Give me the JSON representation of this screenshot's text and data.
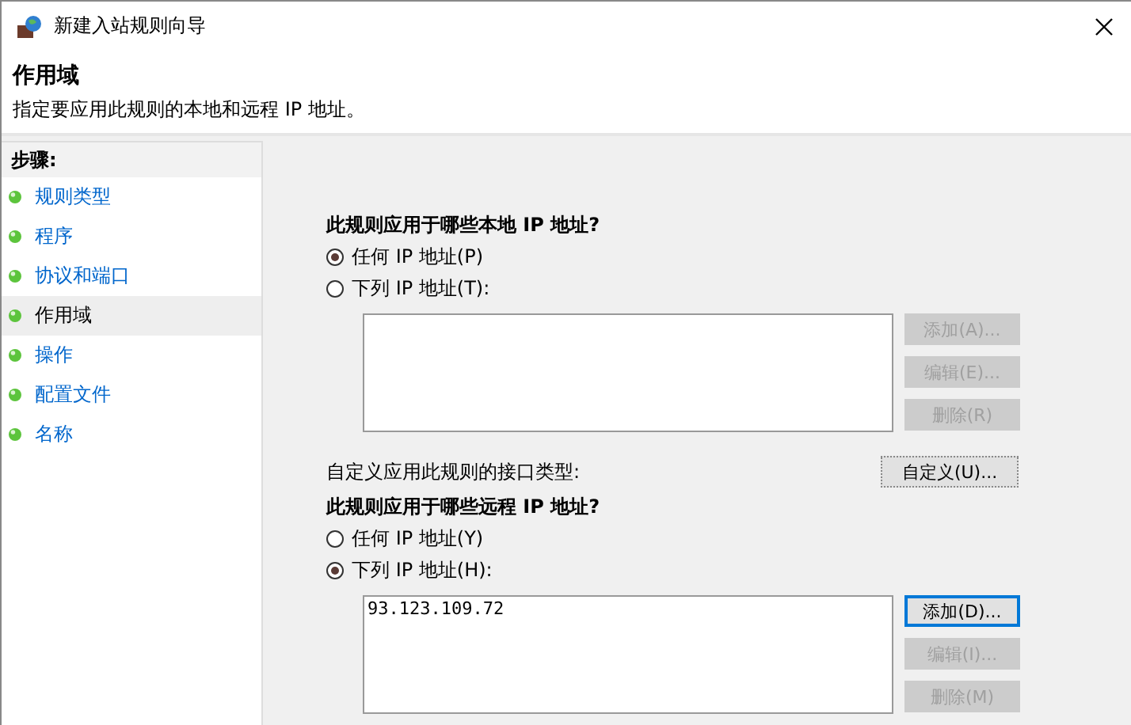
{
  "window": {
    "title": "新建入站规则向导"
  },
  "header": {
    "title": "作用域",
    "description": "指定要应用此规则的本地和远程 IP 地址。"
  },
  "steps": {
    "heading": "步骤:",
    "items": [
      {
        "label": "规则类型",
        "selected": false
      },
      {
        "label": "程序",
        "selected": false
      },
      {
        "label": "协议和端口",
        "selected": false
      },
      {
        "label": "作用域",
        "selected": true
      },
      {
        "label": "操作",
        "selected": false
      },
      {
        "label": "配置文件",
        "selected": false
      },
      {
        "label": "名称",
        "selected": false
      }
    ]
  },
  "local": {
    "heading": "此规则应用于哪些本地 IP 地址?",
    "options": [
      {
        "label": "任何 IP 地址(P)",
        "selected": true
      },
      {
        "label": "下列 IP 地址(T):",
        "selected": false
      }
    ],
    "buttons": [
      {
        "label": "添加(A)...",
        "disabled": true,
        "focused": false
      },
      {
        "label": "编辑(E)...",
        "disabled": true,
        "focused": false
      },
      {
        "label": "删除(R)",
        "disabled": true,
        "focused": false
      }
    ]
  },
  "interface": {
    "label": "自定义应用此规则的接口类型:",
    "button": "自定义(U)..."
  },
  "remote": {
    "heading": "此规则应用于哪些远程 IP 地址?",
    "options": [
      {
        "label": "任何 IP 地址(Y)",
        "selected": false
      },
      {
        "label": "下列 IP 地址(H):",
        "selected": true
      }
    ],
    "addresses": [
      "93.123.109.72"
    ],
    "buttons": [
      {
        "label": "添加(D)...",
        "disabled": false,
        "focused": true
      },
      {
        "label": "编辑(I)...",
        "disabled": true,
        "focused": false
      },
      {
        "label": "删除(M)",
        "disabled": true,
        "focused": false
      }
    ]
  }
}
